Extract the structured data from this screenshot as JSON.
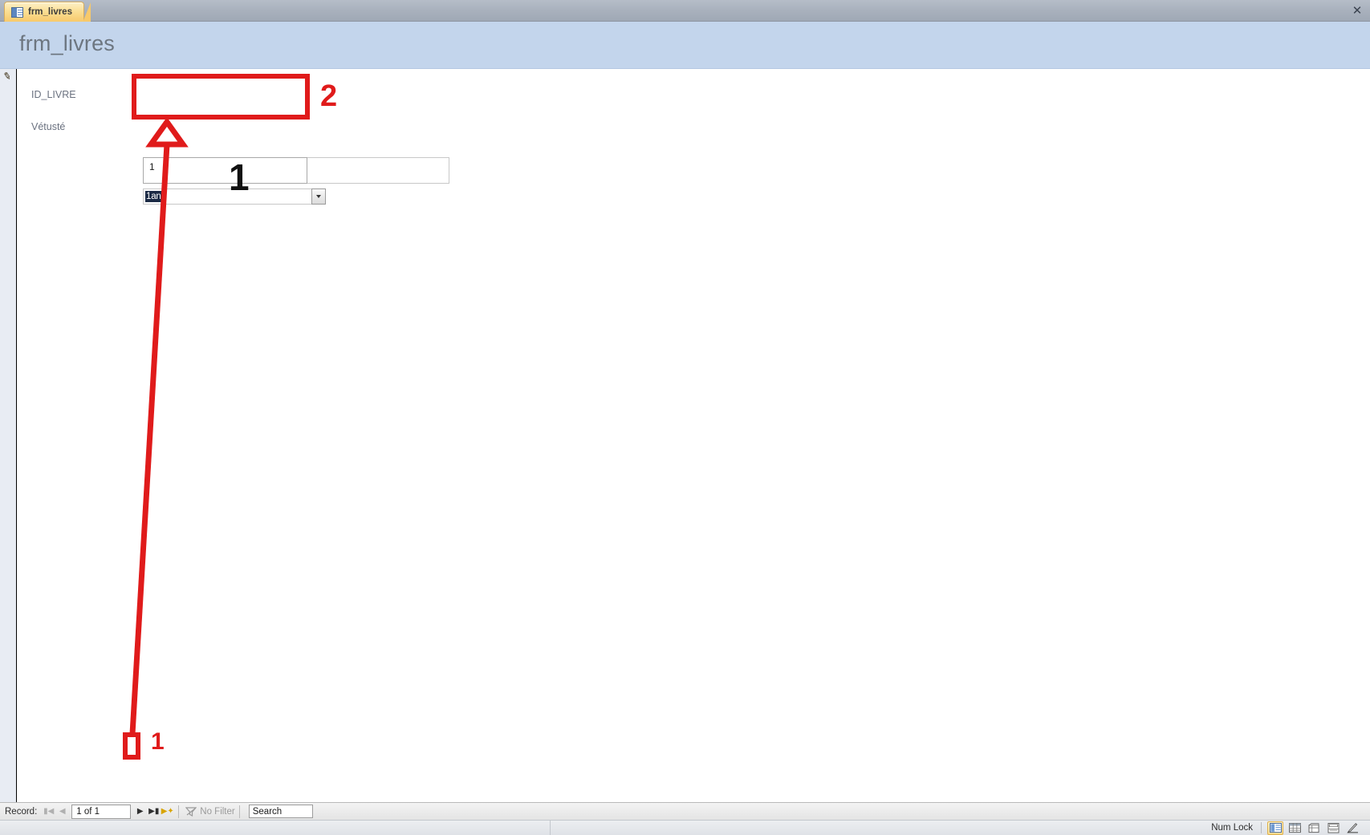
{
  "window": {
    "tab_label": "frm_livres",
    "tab_icon": "form-icon",
    "close_icon": "close-icon"
  },
  "form": {
    "header_title": "frm_livres",
    "record_selector_icon": "edit-pencil-icon",
    "fields": [
      {
        "label": "ID_LIVRE",
        "value": "1",
        "type": "textbox"
      },
      {
        "label": "Vétusté",
        "value": "1an",
        "type": "combobox",
        "dropdown_icon": "chevron-down-icon"
      }
    ]
  },
  "annotations": [
    {
      "id": "anno-2",
      "text": "2",
      "color": "#e01b1b",
      "shape": "rectangle-highlight",
      "target": "ID_LIVRE textbox"
    },
    {
      "id": "anno-1-black",
      "text": "1",
      "color": "#111111",
      "shape": "step-number"
    },
    {
      "id": "anno-1-red",
      "text": "1",
      "color": "#e01b1b",
      "shape": "rectangle-highlight",
      "target": "new-record-button"
    },
    {
      "id": "anno-arrow",
      "shape": "arrow",
      "color": "#e01b1b",
      "from": "new-record-button",
      "to": "Vétusté combobox"
    }
  ],
  "navbar": {
    "record_label": "Record:",
    "first_icon": "first-record-icon",
    "prev_icon": "previous-record-icon",
    "position_value": "1 of 1",
    "next_icon": "next-record-icon",
    "last_icon": "last-record-icon",
    "new_icon": "new-record-icon",
    "filter_icon": "filter-icon",
    "filter_label": "No Filter",
    "search_value": "Search"
  },
  "statusbar": {
    "numlock_label": "Num Lock",
    "views": [
      {
        "name": "form-view-icon",
        "active": true
      },
      {
        "name": "datasheet-view-icon",
        "active": false
      },
      {
        "name": "pivottable-view-icon",
        "active": false
      },
      {
        "name": "layout-view-icon",
        "active": false
      },
      {
        "name": "design-view-icon",
        "active": false
      }
    ]
  },
  "colors": {
    "header_bg": "#c3d5ec",
    "tab_active": "#f7c96b",
    "annotation_red": "#e01b1b",
    "label_text": "#6b7280",
    "selection_bg": "#1b2a45"
  }
}
